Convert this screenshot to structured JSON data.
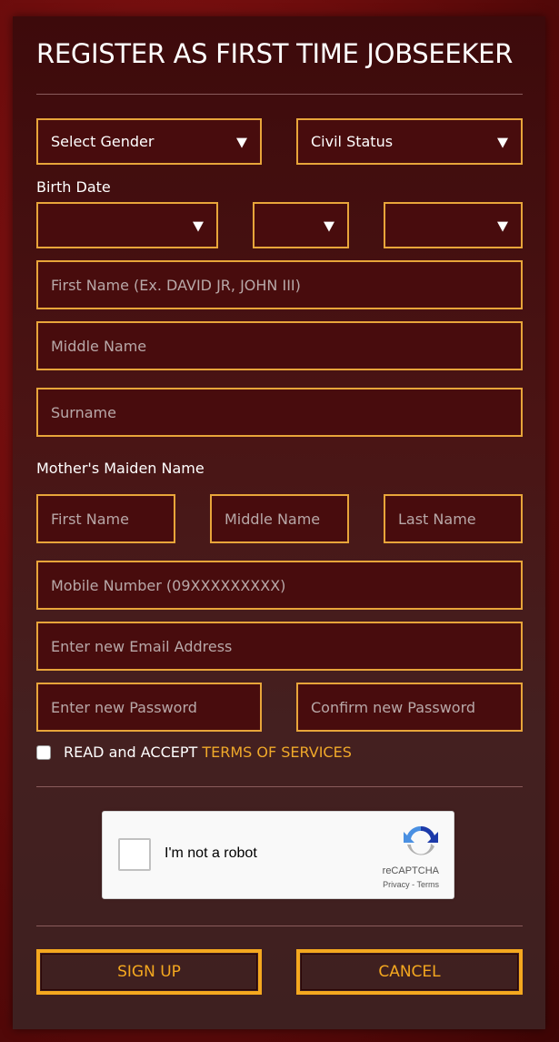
{
  "form": {
    "title": "REGISTER AS FIRST TIME JOBSEEKER",
    "gender_select": "Select Gender",
    "civil_status_select": "Civil Status",
    "birth_date_label": "Birth Date",
    "birth_month": "",
    "birth_day": "",
    "birth_year": "",
    "first_name_placeholder": "First Name (Ex. DAVID JR, JOHN III)",
    "middle_name_placeholder": "Middle Name",
    "surname_placeholder": "Surname",
    "mothers_maiden_label": "Mother's Maiden Name",
    "mother_first_placeholder": "First Name",
    "mother_middle_placeholder": "Middle Name",
    "mother_last_placeholder": "Last Name",
    "mobile_placeholder": "Mobile Number (09XXXXXXXXX)",
    "email_placeholder": "Enter new Email Address",
    "password_placeholder": "Enter new Password",
    "confirm_password_placeholder": "Confirm new Password",
    "terms_text": "READ and ACCEPT",
    "terms_link": "TERMS OF SERVICES"
  },
  "captcha": {
    "label": "I'm not a robot",
    "brand": "reCAPTCHA",
    "links": "Privacy - Terms"
  },
  "actions": {
    "sign_up": "SIGN UP",
    "cancel": "CANCEL"
  },
  "colors": {
    "accent": "#f5a81f",
    "field_border": "#e8a53a",
    "field_bg": "#480c0d"
  }
}
